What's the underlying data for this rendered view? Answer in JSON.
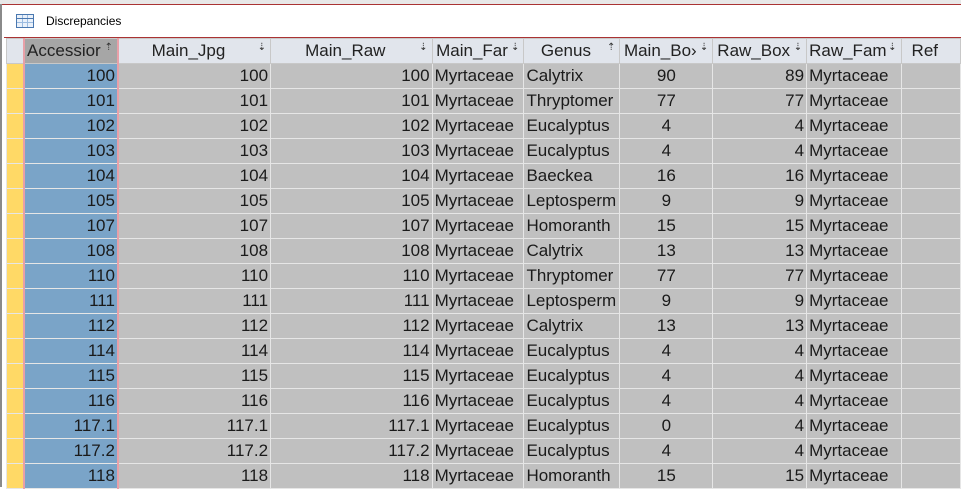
{
  "title": "Discrepancies",
  "columns": [
    "Accessior",
    "Main_Jpg",
    "Main_Raw",
    "Main_Far",
    "Genus",
    "Main_Bo›",
    "Raw_Box",
    "Raw_Fam",
    "Ref"
  ],
  "rows": [
    [
      "100",
      "100",
      "100",
      "Myrtaceae",
      "Calytrix",
      "90",
      "89",
      "Myrtaceae"
    ],
    [
      "101",
      "101",
      "101",
      "Myrtaceae",
      "Thryptomer",
      "77",
      "77",
      "Myrtaceae"
    ],
    [
      "102",
      "102",
      "102",
      "Myrtaceae",
      "Eucalyptus",
      "4",
      "4",
      "Myrtaceae"
    ],
    [
      "103",
      "103",
      "103",
      "Myrtaceae",
      "Eucalyptus",
      "4",
      "4",
      "Myrtaceae"
    ],
    [
      "104",
      "104",
      "104",
      "Myrtaceae",
      "Baeckea",
      "16",
      "16",
      "Myrtaceae"
    ],
    [
      "105",
      "105",
      "105",
      "Myrtaceae",
      "Leptosperm",
      "9",
      "9",
      "Myrtaceae"
    ],
    [
      "107",
      "107",
      "107",
      "Myrtaceae",
      "Homoranth",
      "15",
      "15",
      "Myrtaceae"
    ],
    [
      "108",
      "108",
      "108",
      "Myrtaceae",
      "Calytrix",
      "13",
      "13",
      "Myrtaceae"
    ],
    [
      "110",
      "110",
      "110",
      "Myrtaceae",
      "Thryptomer",
      "77",
      "77",
      "Myrtaceae"
    ],
    [
      "111",
      "111",
      "111",
      "Myrtaceae",
      "Leptosperm",
      "9",
      "9",
      "Myrtaceae"
    ],
    [
      "112",
      "112",
      "112",
      "Myrtaceae",
      "Calytrix",
      "13",
      "13",
      "Myrtaceae"
    ],
    [
      "114",
      "114",
      "114",
      "Myrtaceae",
      "Eucalyptus",
      "4",
      "4",
      "Myrtaceae"
    ],
    [
      "115",
      "115",
      "115",
      "Myrtaceae",
      "Eucalyptus",
      "4",
      "4",
      "Myrtaceae"
    ],
    [
      "116",
      "116",
      "116",
      "Myrtaceae",
      "Eucalyptus",
      "4",
      "4",
      "Myrtaceae"
    ],
    [
      "117.1",
      "117.1",
      "117.1",
      "Myrtaceae",
      "Eucalyptus",
      "0",
      "4",
      "Myrtaceae"
    ],
    [
      "117.2",
      "117.2",
      "117.2",
      "Myrtaceae",
      "Eucalyptus",
      "4",
      "4",
      "Myrtaceae"
    ],
    [
      "118",
      "118",
      "118",
      "Myrtaceae",
      "Homoranth",
      "15",
      "15",
      "Myrtaceae"
    ]
  ]
}
